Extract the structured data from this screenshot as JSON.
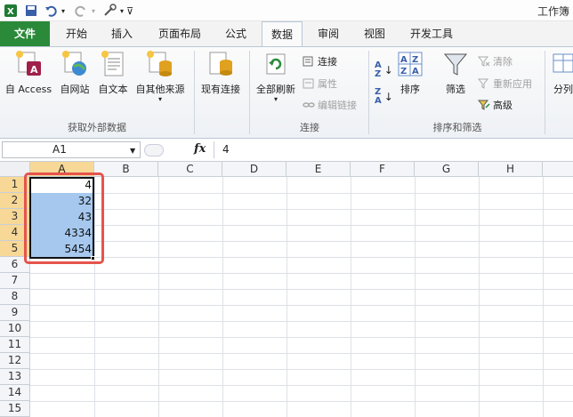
{
  "window": {
    "title": "工作簿"
  },
  "tabs": [
    {
      "label": "文件"
    },
    {
      "label": "开始"
    },
    {
      "label": "插入"
    },
    {
      "label": "页面布局"
    },
    {
      "label": "公式"
    },
    {
      "label": "数据"
    },
    {
      "label": "审阅"
    },
    {
      "label": "视图"
    },
    {
      "label": "开发工具"
    }
  ],
  "ribbon": {
    "external": {
      "access": "自 Access",
      "web": "自网站",
      "text": "自文本",
      "other": "自其他来源",
      "group": "获取外部数据"
    },
    "existing_conn": "现有连接",
    "connections": {
      "refresh_all": "全部刷新",
      "connections": "连接",
      "properties": "属性",
      "edit_links": "编辑链接",
      "group": "连接"
    },
    "sort": {
      "sort": "排序",
      "filter": "筛选",
      "clear": "清除",
      "reapply": "重新应用",
      "advanced": "高级",
      "group": "排序和筛选"
    },
    "split": "分列"
  },
  "formula_bar": {
    "name_box": "A1",
    "fx": "fx",
    "value": "4"
  },
  "columns": [
    "A",
    "B",
    "C",
    "D",
    "E",
    "F",
    "G",
    "H",
    "I"
  ],
  "rows": [
    "1",
    "2",
    "3",
    "4",
    "5",
    "6",
    "7",
    "8",
    "9",
    "10",
    "11",
    "12",
    "13",
    "14",
    "15"
  ],
  "cells": {
    "A1": "4",
    "A2": "32",
    "A3": "43",
    "A4": "4334",
    "A5": "5454"
  },
  "colors": {
    "file_tab": "#2a8a3a",
    "selection": "#a6c8ee",
    "highlight_box": "#e5544c",
    "header_selected": "#f7d896"
  }
}
